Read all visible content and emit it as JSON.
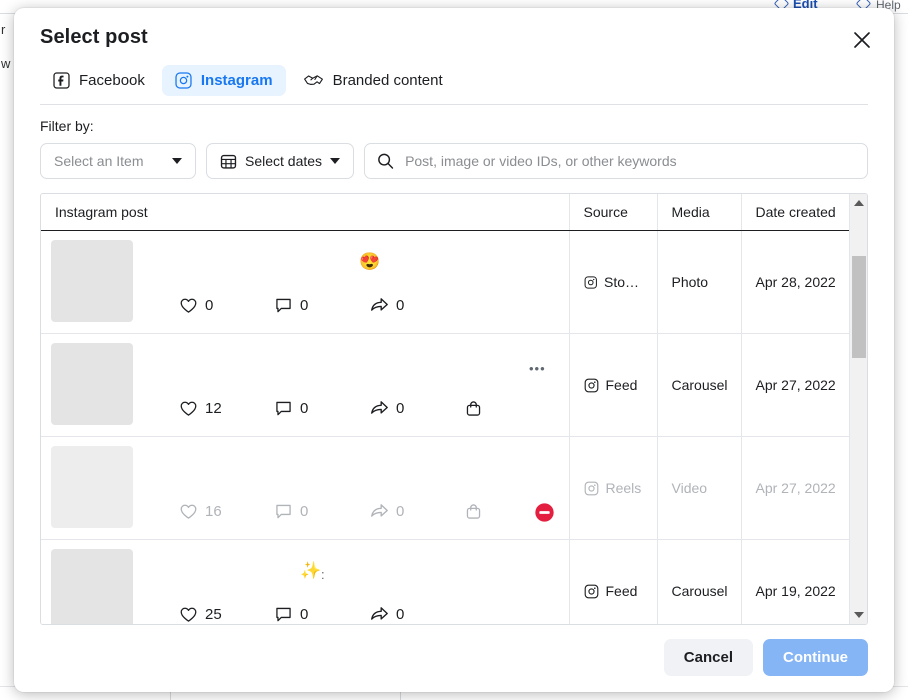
{
  "background": {
    "edit_link": "Edit",
    "help_chip": "Help",
    "left_text_1": "r",
    "left_text_2": "w"
  },
  "modal": {
    "title": "Select post",
    "close_icon": "close-icon"
  },
  "tabs": [
    {
      "label": "Facebook",
      "icon": "facebook-icon",
      "active": false
    },
    {
      "label": "Instagram",
      "icon": "instagram-icon",
      "active": true
    },
    {
      "label": "Branded content",
      "icon": "handshake-icon",
      "active": false
    }
  ],
  "filters": {
    "label": "Filter by:",
    "item_select": {
      "value": "Select an Item",
      "icon": "chevron-down-icon"
    },
    "dates_select": {
      "value": "Select dates",
      "icon": "calendar-icon",
      "caret": "chevron-down-icon"
    },
    "search": {
      "value": "",
      "placeholder": "Post, image or video IDs, or other keywords",
      "icon": "search-icon"
    }
  },
  "table": {
    "columns": [
      "Instagram post",
      "Source",
      "Media",
      "Date created"
    ],
    "rows": [
      {
        "emoji": "😍",
        "emoji_name": "heart-eyes-emoji",
        "dots": "",
        "likes": "0",
        "comments": "0",
        "shares": "0",
        "has_shopping": false,
        "blocked": false,
        "source": "Stori…",
        "media": "Photo",
        "date": "Apr 28, 2022",
        "disabled": false
      },
      {
        "emoji": "",
        "emoji_name": "",
        "dots": "•••",
        "likes": "12",
        "comments": "0",
        "shares": "0",
        "has_shopping": true,
        "blocked": false,
        "source": "Feed",
        "media": "Carousel",
        "date": "Apr 27, 2022",
        "disabled": false
      },
      {
        "emoji": "",
        "emoji_name": "",
        "dots": "",
        "likes": "16",
        "comments": "0",
        "shares": "0",
        "has_shopping": true,
        "blocked": true,
        "source": "Reels",
        "media": "Video",
        "date": "Apr 27, 2022",
        "disabled": true
      },
      {
        "emoji": "✨",
        "emoji_name": "sparkles-emoji",
        "dots": ":",
        "likes": "25",
        "comments": "0",
        "shares": "0",
        "has_shopping": false,
        "blocked": false,
        "source": "Feed",
        "media": "Carousel",
        "date": "Apr 19, 2022",
        "disabled": false
      }
    ]
  },
  "footer": {
    "cancel_label": "Cancel",
    "continue_label": "Continue"
  },
  "colors": {
    "accent_blue": "#1877f2",
    "accent_blue_soft": "#e7f3ff",
    "continue_disabled": "#86b5f5",
    "blocked_red": "#e41e3f",
    "thumb_gray": "#e4e4e4",
    "text_primary": "#1c1e21",
    "text_muted": "#8a8d91",
    "text_disabled": "#b0b3b8",
    "border": "#dadde1"
  }
}
